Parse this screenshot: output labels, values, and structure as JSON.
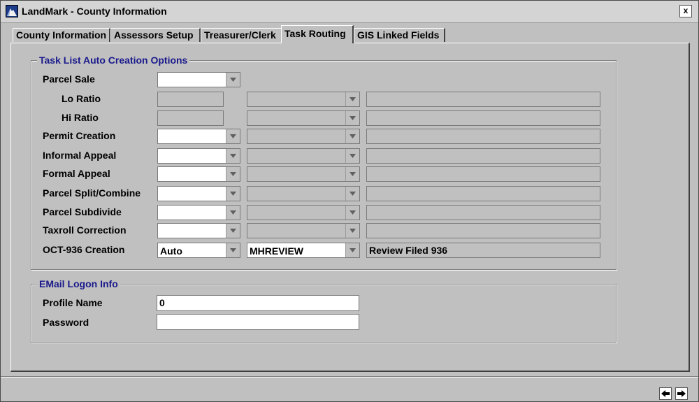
{
  "window": {
    "title": "LandMark - County Information",
    "close_label": "x"
  },
  "tabs": [
    {
      "label": "County Information",
      "active": false
    },
    {
      "label": "Assessors Setup",
      "active": false
    },
    {
      "label": "Treasurer/Clerk",
      "active": false
    },
    {
      "label": "Task Routing",
      "active": true
    },
    {
      "label": "GIS Linked Fields",
      "active": false
    }
  ],
  "task_group": {
    "title": "Task List Auto Creation Options",
    "rows": [
      {
        "label": "Parcel Sale",
        "type_value": "",
        "queue_value": "",
        "desc_value": ""
      },
      {
        "label": "Lo Ratio",
        "type_value": "",
        "queue_value": "",
        "desc_value": ""
      },
      {
        "label": "Hi Ratio",
        "type_value": "",
        "queue_value": "",
        "desc_value": ""
      },
      {
        "label": "Permit Creation",
        "type_value": "",
        "queue_value": "",
        "desc_value": ""
      },
      {
        "label": "Informal Appeal",
        "type_value": "",
        "queue_value": "",
        "desc_value": ""
      },
      {
        "label": "Formal Appeal",
        "type_value": "",
        "queue_value": "",
        "desc_value": ""
      },
      {
        "label": "Parcel Split/Combine",
        "type_value": "",
        "queue_value": "",
        "desc_value": ""
      },
      {
        "label": "Parcel Subdivide",
        "type_value": "",
        "queue_value": "",
        "desc_value": ""
      },
      {
        "label": "Taxroll Correction",
        "type_value": "",
        "queue_value": "",
        "desc_value": ""
      },
      {
        "label": "OCT-936 Creation",
        "type_value": "Auto",
        "queue_value": "MHREVIEW",
        "desc_value": "Review Filed 936"
      }
    ]
  },
  "email_group": {
    "title": "EMail Logon Info",
    "profile_label": "Profile Name",
    "profile_value": "0",
    "password_label": "Password",
    "password_value": ""
  },
  "icons": {
    "app": "landmark-app-icon",
    "dropdown": "chevron-down-icon",
    "prev": "arrow-left-icon",
    "next": "arrow-right-icon"
  }
}
